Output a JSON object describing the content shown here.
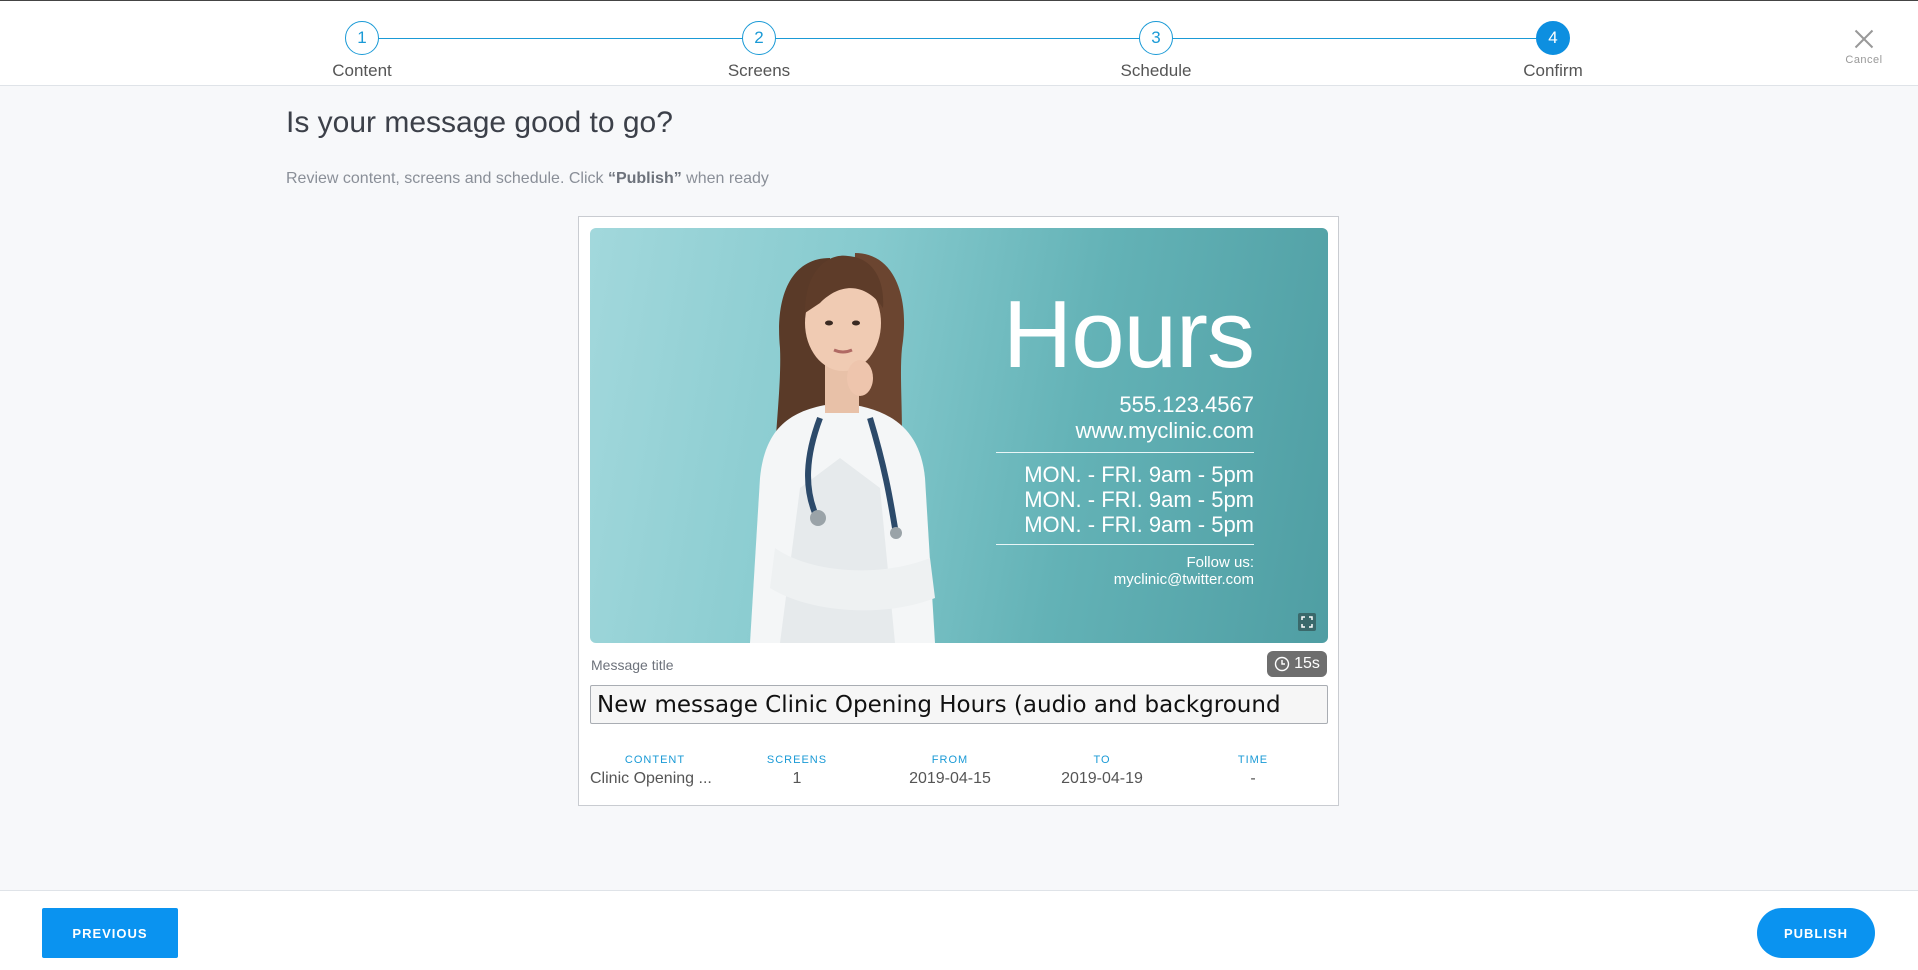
{
  "stepper": {
    "steps": [
      {
        "number": "1",
        "label": "Content"
      },
      {
        "number": "2",
        "label": "Screens"
      },
      {
        "number": "3",
        "label": "Schedule"
      },
      {
        "number": "4",
        "label": "Confirm"
      }
    ],
    "active_step": 4,
    "cancel_label": "Cancel"
  },
  "page": {
    "title": "Is your message good to go?",
    "subtitle_before": "Review content, screens and schedule. Click ",
    "subtitle_emphasis": "“Publish”",
    "subtitle_after": " when ready"
  },
  "preview": {
    "headline": "Hours",
    "phone": "555.123.4567",
    "website": "www.myclinic.com",
    "hours_lines": [
      "MON. - FRI. 9am - 5pm",
      "MON. - FRI. 9am - 5pm",
      "MON. - FRI. 9am - 5pm"
    ],
    "follow_label": "Follow us:",
    "twitter": "myclinic@twitter.com",
    "expand_icon": "expand-icon"
  },
  "message": {
    "title_label": "Message title",
    "duration": "15s",
    "title_value": "New message Clinic Opening Hours (audio and background"
  },
  "summary": {
    "columns": [
      {
        "header": "CONTENT",
        "value": "Clinic Opening ..."
      },
      {
        "header": "SCREENS",
        "value": "1"
      },
      {
        "header": "FROM",
        "value": "2019-04-15"
      },
      {
        "header": "TO",
        "value": "2019-04-19"
      },
      {
        "header": "TIME",
        "value": "-"
      }
    ]
  },
  "footer": {
    "previous_label": "PREVIOUS",
    "publish_label": "PUBLISH"
  },
  "colors": {
    "accent": "#0a93f0",
    "step_line": "#1a9ad6",
    "preview_teal": "#63b2b6"
  }
}
